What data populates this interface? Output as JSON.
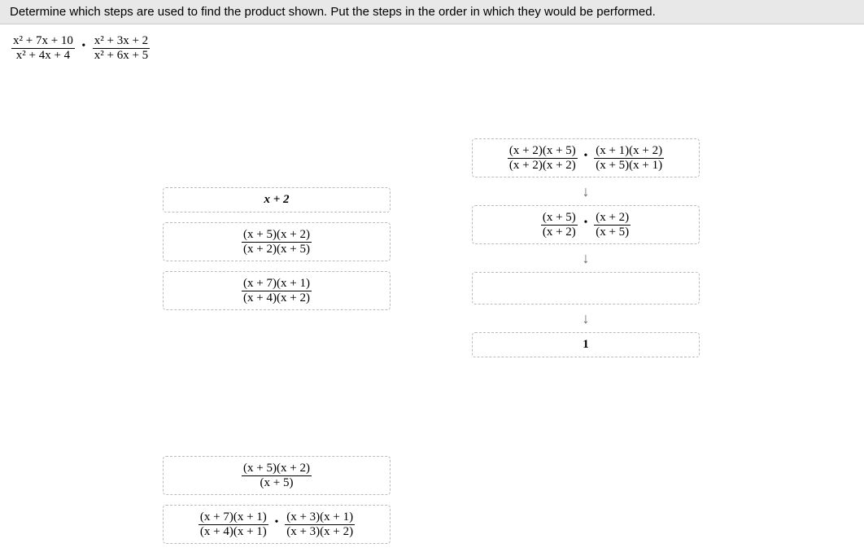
{
  "header": "Determine which steps are used to find the product shown. Put the steps in the order in which they would be performed.",
  "problem": {
    "frac1_num": "x² + 7x + 10",
    "frac1_den": "x² + 4x + 4",
    "frac2_num": "x² + 3x + 2",
    "frac2_den": "x² + 6x + 5"
  },
  "cards": {
    "c1": "x + 2",
    "c2_num": "(x + 5)(x + 2)",
    "c2_den": "(x + 2)(x + 5)",
    "c3_num": "(x + 7)(x + 1)",
    "c3_den": "(x + 4)(x + 2)",
    "c4_num": "(x + 5)(x + 2)",
    "c4_den": "(x + 5)",
    "c5_left_num": "(x + 7)(x + 1)",
    "c5_left_den": "(x + 4)(x + 1)",
    "c5_right_num": "(x + 3)(x + 1)",
    "c5_right_den": "(x + 3)(x + 2)"
  },
  "right": {
    "r1_left_num": "(x + 2)(x + 5)",
    "r1_left_den": "(x + 2)(x + 2)",
    "r1_right_num": "(x + 1)(x + 2)",
    "r1_right_den": "(x + 5)(x + 1)",
    "r2_left_num": "(x + 5)",
    "r2_left_den": "(x + 2)",
    "r2_right_num": "(x + 2)",
    "r2_right_den": "(x + 5)",
    "r4": "1"
  }
}
